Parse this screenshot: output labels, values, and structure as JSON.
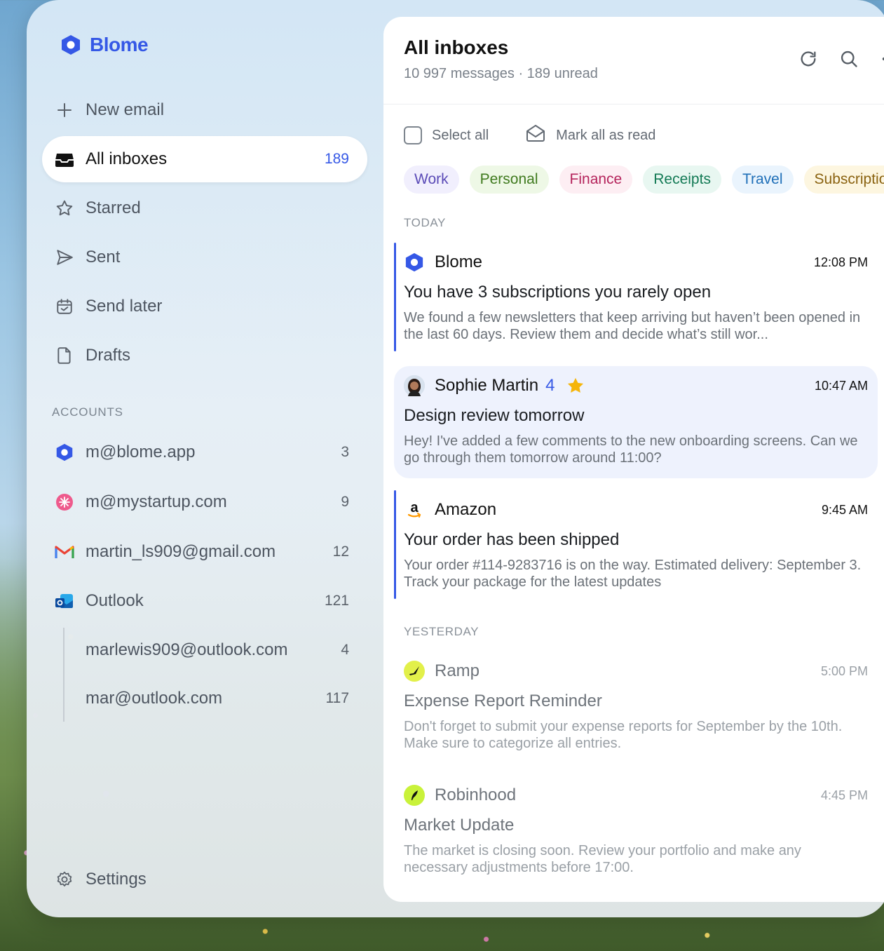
{
  "app": {
    "name": "Blome"
  },
  "sidebar": {
    "new_email": "New email",
    "nav": [
      {
        "label": "All inboxes",
        "count": "189",
        "icon": "inbox-icon"
      },
      {
        "label": "Starred",
        "icon": "star-icon"
      },
      {
        "label": "Sent",
        "icon": "send-icon"
      },
      {
        "label": "Send later",
        "icon": "calendar-clock-icon"
      },
      {
        "label": "Drafts",
        "icon": "file-icon"
      }
    ],
    "accounts_label": "ACCOUNTS",
    "accounts": [
      {
        "label": "m@blome.app",
        "count": "3",
        "icon": "blome-logo-icon"
      },
      {
        "label": "m@mystartup.com",
        "count": "9",
        "icon": "mystartup-logo-icon"
      },
      {
        "label": "martin_ls909@gmail.com",
        "count": "12",
        "icon": "gmail-logo-icon"
      },
      {
        "label": "Outlook",
        "count": "121",
        "icon": "outlook-logo-icon"
      },
      {
        "label": "marlewis909@outlook.com",
        "count": "4"
      },
      {
        "label": "mar@outlook.com",
        "count": "117"
      }
    ],
    "settings": "Settings"
  },
  "main": {
    "title": "All inboxes",
    "subtitle": "10 997 messages · 189 unread",
    "select_all": "Select all",
    "mark_all_read": "Mark all as read",
    "chips": [
      {
        "label": "Work",
        "bg": "#f1effd",
        "fg": "#5b4bb7"
      },
      {
        "label": "Personal",
        "bg": "#eef8e6",
        "fg": "#3f7a1e"
      },
      {
        "label": "Finance",
        "bg": "#fdeef3",
        "fg": "#b5245c"
      },
      {
        "label": "Receipts",
        "bg": "#e8f7f1",
        "fg": "#137a55"
      },
      {
        "label": "Travel",
        "bg": "#eaf4fd",
        "fg": "#1f6fb8"
      },
      {
        "label": "Subscriptions",
        "bg": "#fdf6e0",
        "fg": "#8a6210"
      }
    ],
    "today_label": "TODAY",
    "yesterday_label": "YESTERDAY",
    "emails": [
      {
        "sender": "Blome",
        "time": "12:08 PM",
        "subject": "You have 3 subscriptions you rarely open",
        "preview": "We found a few newsletters that keep arriving but haven’t been opened in the last 60 days. Review them and decide what’s still wor...",
        "icon": "blome-logo-icon"
      },
      {
        "sender": "Sophie Martin",
        "count": "4",
        "starred": true,
        "time": "10:47 AM",
        "subject": "Design review tomorrow",
        "preview": "Hey! I've added a few comments to the new onboarding screens. Can we go through them tomorrow around 11:00?",
        "icon": "avatar"
      },
      {
        "sender": "Amazon",
        "time": "9:45 AM",
        "subject": "Your order has been shipped",
        "preview": "Your order #114-9283716 is on the way. Estimated delivery: September 3. Track your package for the latest updates",
        "icon": "amazon-logo-icon"
      },
      {
        "sender": "Ramp",
        "time": "5:00 PM",
        "subject": "Expense Report Reminder",
        "preview": "Don't forget to submit your expense reports for September by the 10th. Make sure to categorize all entries.",
        "icon": "ramp-logo-icon"
      },
      {
        "sender": "Robinhood",
        "time": "4:45 PM",
        "subject": "Market Update",
        "preview": "The market is closing soon. Review your portfolio and make any necessary adjustments before 17:00.",
        "icon": "robinhood-logo-icon"
      }
    ]
  },
  "colors": {
    "accent": "#3558e6"
  }
}
